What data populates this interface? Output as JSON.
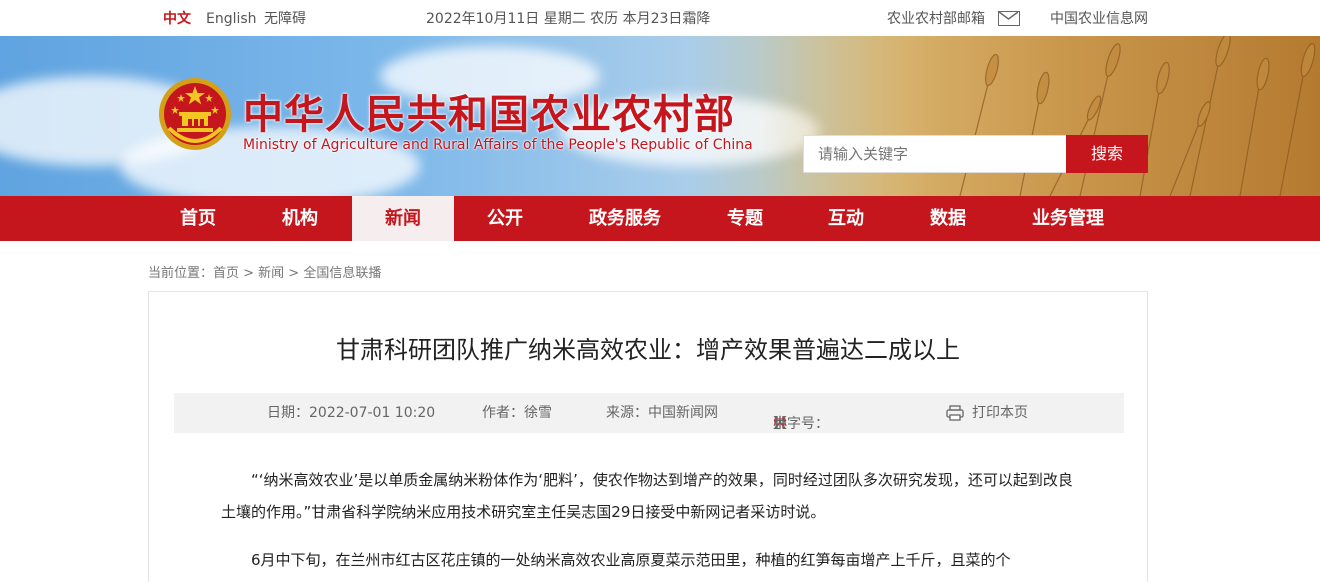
{
  "topbar": {
    "lang_cn": "中文",
    "lang_en": "English",
    "accessibility": "无障碍",
    "date": "2022年10月11日 星期二 农历 本月23日霜降",
    "mailbox": "农业农村部邮箱",
    "info_net": "中国农业信息网"
  },
  "header": {
    "title": "中华人民共和国农业农村部",
    "subtitle": "Ministry of Agriculture and Rural Affairs of the People's Republic of China",
    "search_placeholder": "请输入关键字",
    "search_button": "搜索"
  },
  "nav": {
    "items": [
      "首页",
      "机构",
      "新闻",
      "公开",
      "政务服务",
      "专题",
      "互动",
      "数据",
      "业务管理"
    ],
    "active": "新闻"
  },
  "breadcrumb": "当前位置：首页 > 新闻 > 全国信息联播",
  "article": {
    "title": "甘肃科研团队推广纳米高效农业：增产效果普遍达二成以上",
    "date": "日期：2022-07-01 10:20",
    "author": "作者：徐雪",
    "source": "来源：中国新闻网",
    "font_label": "【字号：",
    "font_large": "大",
    "font_medium": "中",
    "font_small": "小",
    "font_end": "】",
    "print": "打印本页",
    "paragraph1": "“‘纳米高效农业’是以单质金属纳米粉体作为‘肥料’，使农作物达到增产的效果，同时经过团队多次研究发现，还可以起到改良土壤的作用。”甘肃省科学院纳米应用技术研究室主任吴志国29日接受中新网记者采访时说。",
    "paragraph2": "6月中下旬，在兰州市红古区花庄镇的一处纳米高效农业高原夏菜示范田里，种植的红笋每亩增产上千斤，且菜的个"
  },
  "colors": {
    "brand_red": "#c4161c",
    "nav_active_bg": "#f6eeee",
    "meta_bg": "#f2f2f2"
  }
}
